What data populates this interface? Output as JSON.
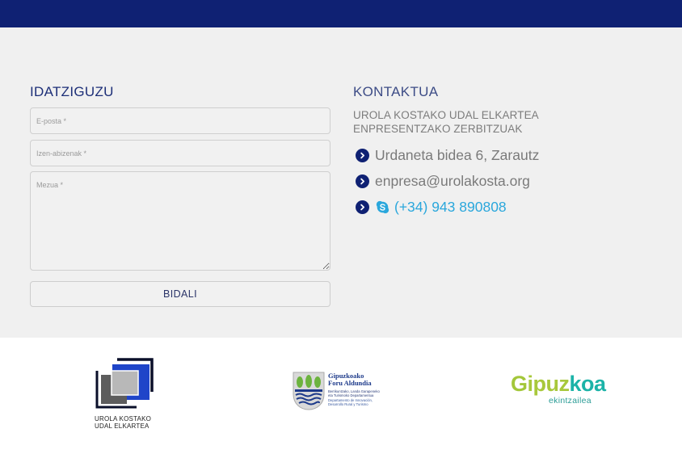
{
  "form": {
    "title": "IDATZIGUZU",
    "email_placeholder": "E-posta *",
    "name_placeholder": "Izen-abizenak *",
    "message_placeholder": "Mezua *",
    "submit_label": "BIDALI"
  },
  "contact": {
    "title": "KONTAKTUA",
    "org_name": "UROLA KOSTAKO UDAL ELKARTEA ENPRESENTZAKO ZERBITZUAK",
    "address": "Urdaneta bidea 6, Zarautz",
    "email": "enpresa@urolakosta.org",
    "phone": "(+34) 943 890808",
    "icons": [
      "chevron-right-icon",
      "skype-icon"
    ],
    "colors": {
      "bullet": "#0f2173",
      "phone_link": "#2aa7dc"
    }
  },
  "footer": {
    "urola_logo": {
      "line1": "UROLA KOSTAKO",
      "line2": "UDAL ELKARTEA"
    },
    "foru_logo": {
      "line1": "Gipuzkoako",
      "line2": "Foru Aldundia",
      "dept_eu_1": "Berrikuntzako, Landa Garapeneko",
      "dept_eu_2": "eta Turismoko Departamentua",
      "dept_es_1": "Departamento de Innovación,",
      "dept_es_2": "Desarrollo Rural y Turismo"
    },
    "gipuzkoa_logo": {
      "part1": "G",
      "part2": "ipuz",
      "part3": "koa",
      "sub": "ekintzailea"
    }
  },
  "theme": {
    "topbar": "#0f2173",
    "main_bg": "#f0f0f0"
  }
}
